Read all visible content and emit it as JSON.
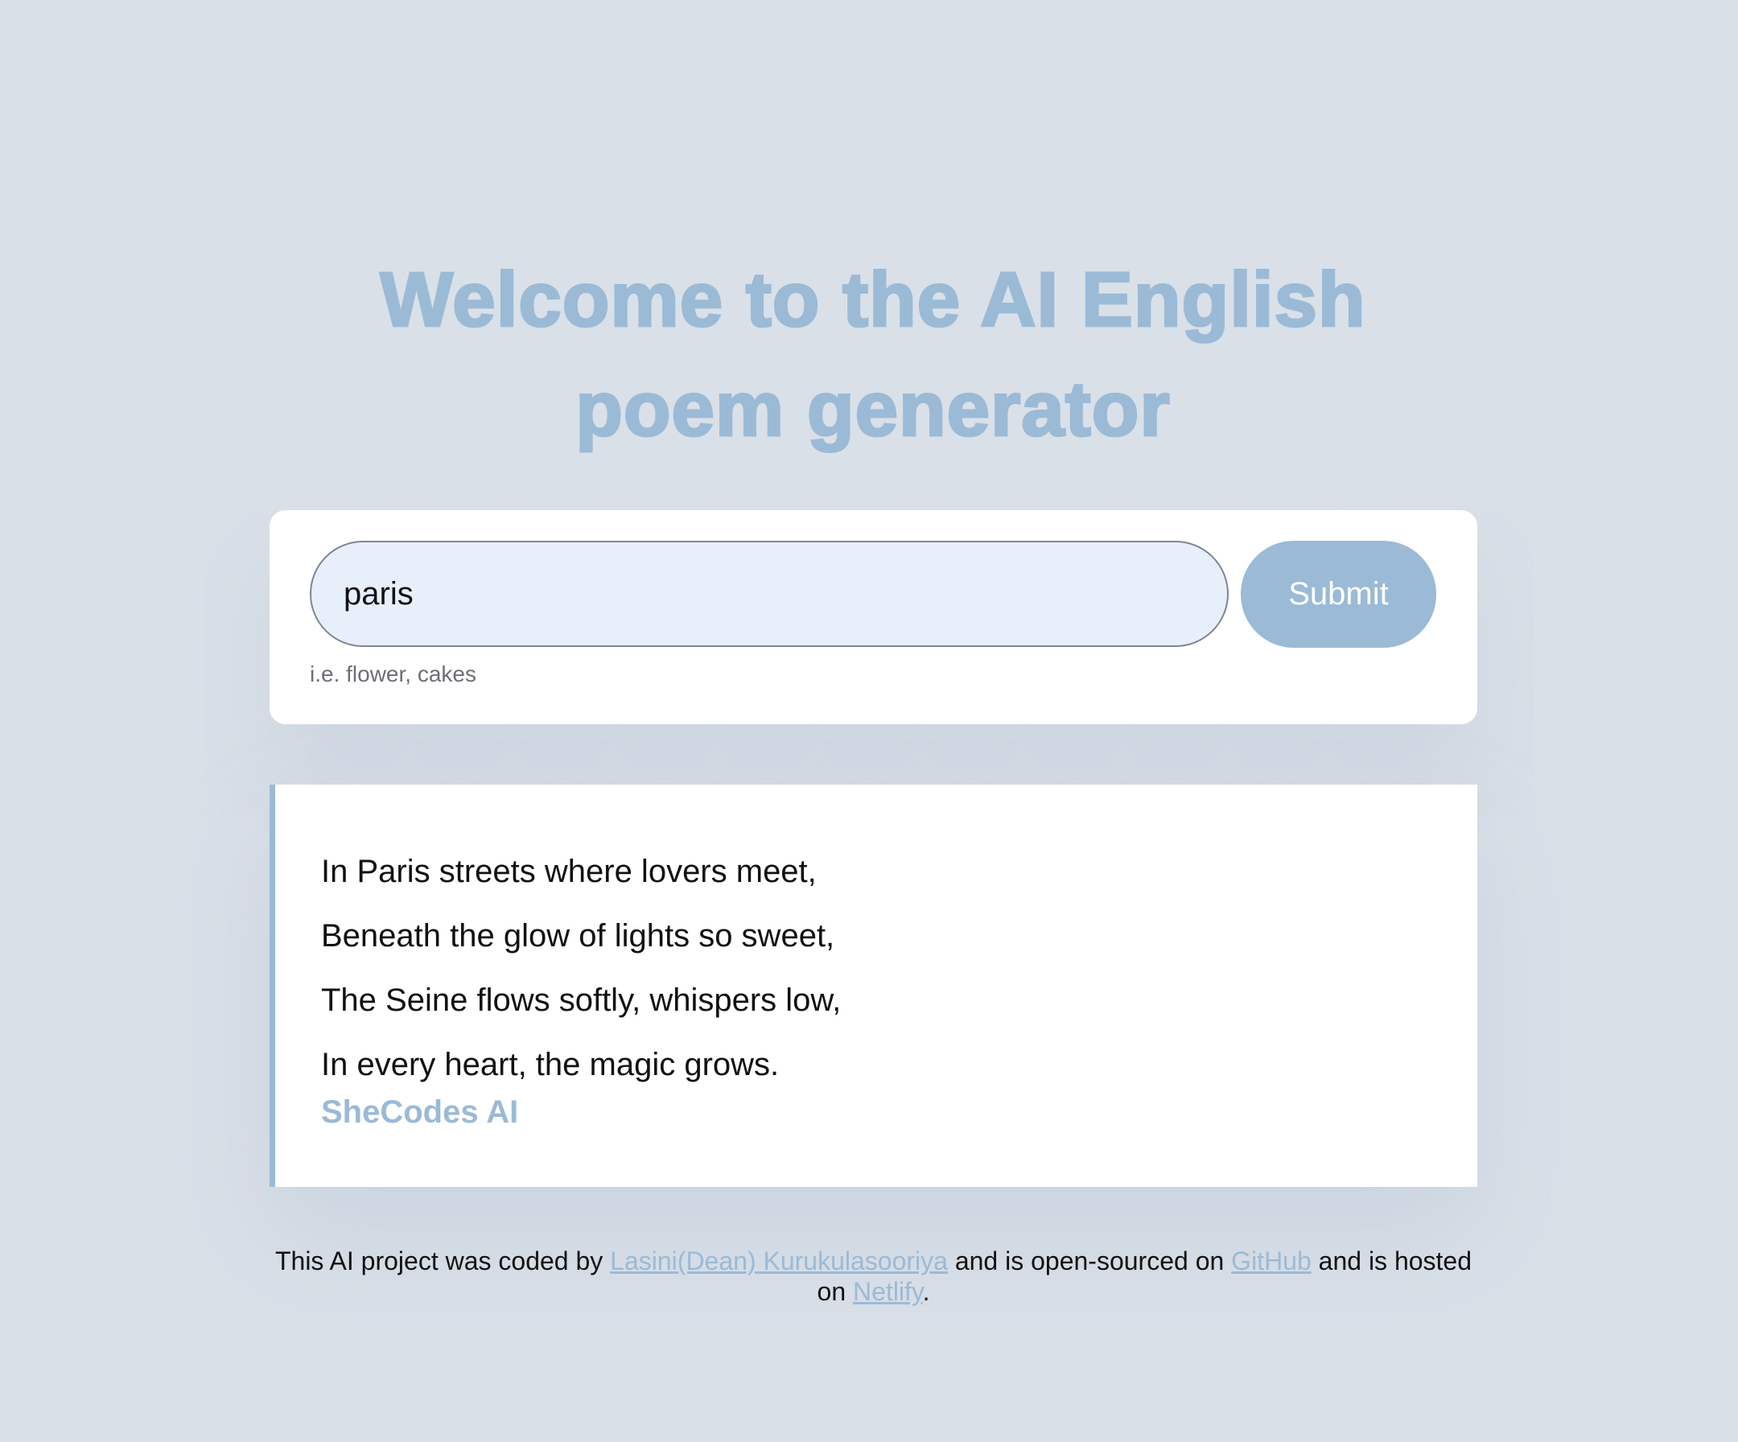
{
  "header": {
    "title_line1": "Welcome to the AI English",
    "title_line2": "poem generator"
  },
  "form": {
    "input_value": "paris",
    "hint": "i.e. flower, cakes",
    "submit_label": "Submit"
  },
  "poem": {
    "lines": [
      "In Paris streets where lovers meet,",
      "Beneath the glow of lights so sweet,",
      "The Seine flows softly, whispers low,",
      "In every heart, the magic grows."
    ],
    "signature": "SheCodes AI"
  },
  "footer": {
    "text_1": "This AI project was coded by ",
    "author_link": "Lasini(Dean) Kurukulasooriya",
    "text_2": " and is open-sourced on ",
    "github_link": "GitHub",
    "text_3": " and is hosted on ",
    "netlify_link": "Netlify",
    "text_4": "."
  },
  "colors": {
    "background": "#d9e0e8",
    "accent": "#9bbad6",
    "input_background": "#e7effb"
  }
}
